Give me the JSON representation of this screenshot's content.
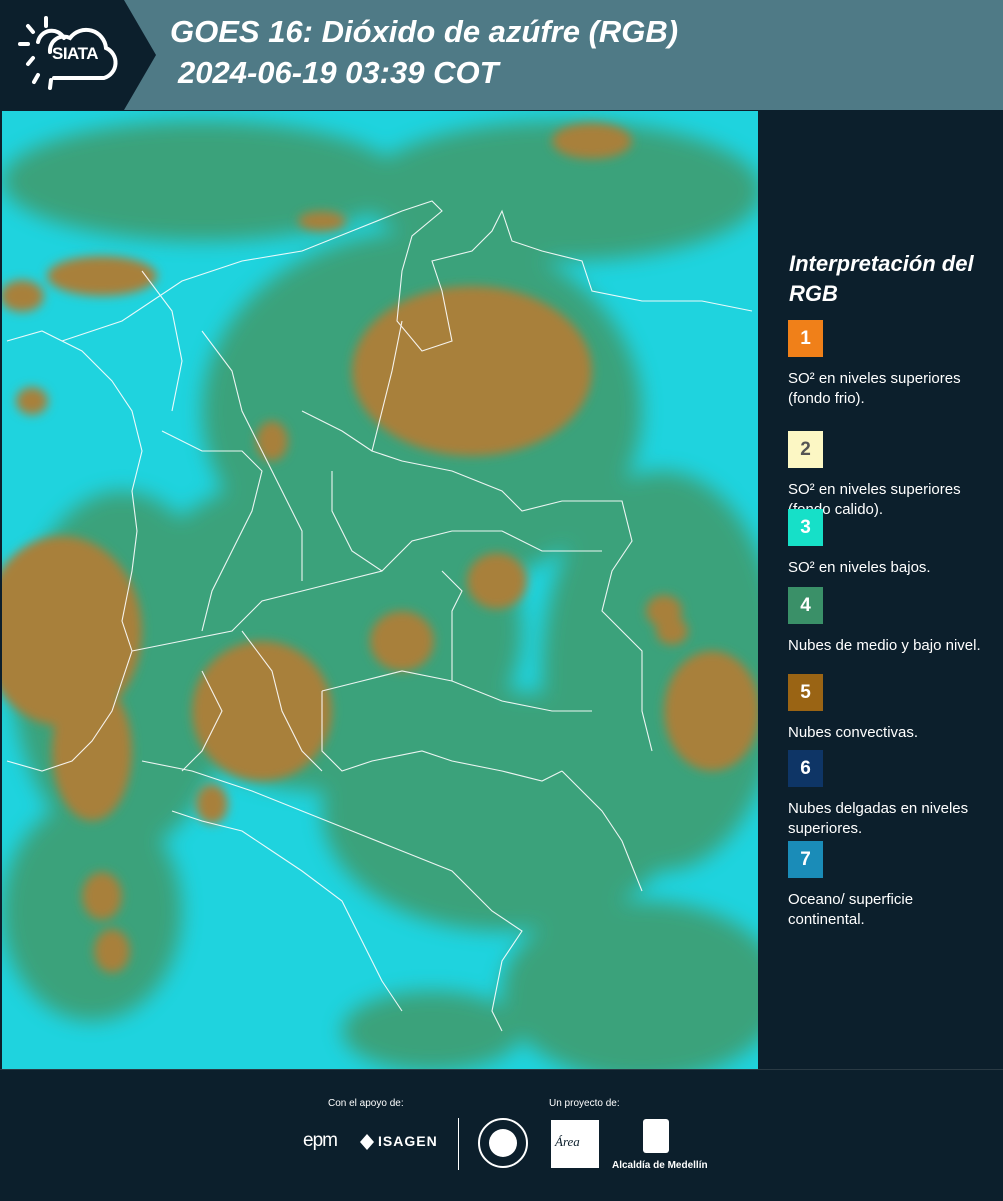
{
  "header": {
    "logo_text": "SIATA",
    "title_line1": "GOES 16: Dióxido de azúfre (RGB)",
    "title_line2": "2024-06-19 03:39 COT"
  },
  "colors": {
    "header_bg": "#4f7a86",
    "panel_bg": "#0c1f2c",
    "map_ocean": "#1fd3de",
    "map_convective": "#a8803a",
    "map_midlevel": "#3f9a6a",
    "boundary_lines": "#ffffff"
  },
  "legend": {
    "title": "Interpretación del RGB",
    "items": [
      {
        "number": "1",
        "label": "SO² en niveles superiores (fondo frio).",
        "color": "#f08019"
      },
      {
        "number": "2",
        "label": "SO² en niveles superiores (fondo calido).",
        "color": "#fcf7c4"
      },
      {
        "number": "3",
        "label": "SO² en niveles bajos.",
        "color": "#16e0c8"
      },
      {
        "number": "4",
        "label": "Nubes de medio y bajo nivel.",
        "color": "#3a9068"
      },
      {
        "number": "5",
        "label": "Nubes convectivas.",
        "color": "#9a6414"
      },
      {
        "number": "6",
        "label": "Nubes delgadas en niveles superiores.",
        "color": "#0e3566"
      },
      {
        "number": "7",
        "label": "Oceano/ superficie continental.",
        "color": "#1a8cb8"
      }
    ]
  },
  "footer": {
    "support_label": "Con el apoyo de:",
    "project_label": "Un proyecto de:",
    "sponsor_1": "epm",
    "sponsor_2": "ISAGEN",
    "partner_1": "Área",
    "partner_2": "Alcaldía de Medellín"
  },
  "icons": [
    "sun-logo-icon",
    "seal-icon",
    "emblem-icon"
  ]
}
